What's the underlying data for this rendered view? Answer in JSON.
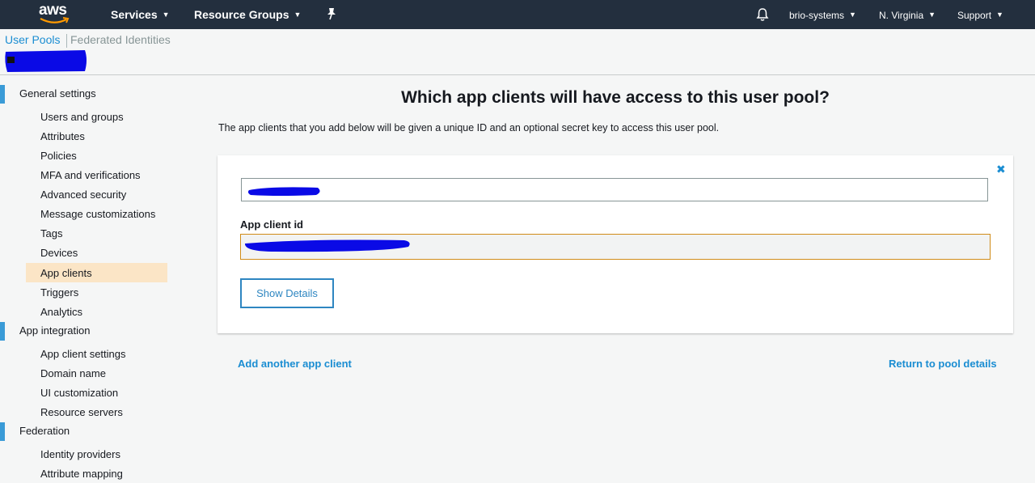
{
  "topbar": {
    "logo_text": "aws",
    "services_label": "Services",
    "resource_groups_label": "Resource Groups",
    "account_label": "brio-systems",
    "region_label": "N. Virginia",
    "support_label": "Support",
    "icons": [
      "pin-icon",
      "bell-icon",
      "caret-down-icon"
    ]
  },
  "subheader": {
    "tabs": [
      {
        "label": "User Pools"
      },
      {
        "label": "Federated Identities"
      }
    ]
  },
  "sidebar": {
    "sections": [
      {
        "label": "General settings"
      },
      {
        "label": "App integration"
      },
      {
        "label": "Federation"
      }
    ],
    "general_items": [
      {
        "label": "Users and groups"
      },
      {
        "label": "Attributes"
      },
      {
        "label": "Policies"
      },
      {
        "label": "MFA and verifications"
      },
      {
        "label": "Advanced security"
      },
      {
        "label": "Message customizations"
      },
      {
        "label": "Tags"
      },
      {
        "label": "Devices"
      },
      {
        "label": "App clients"
      },
      {
        "label": "Triggers"
      },
      {
        "label": "Analytics"
      }
    ],
    "app_integration_items": [
      {
        "label": "App client settings"
      },
      {
        "label": "Domain name"
      },
      {
        "label": "UI customization"
      },
      {
        "label": "Resource servers"
      }
    ],
    "federation_items": [
      {
        "label": "Identity providers"
      },
      {
        "label": "Attribute mapping"
      }
    ],
    "active_item": "App clients"
  },
  "main": {
    "title": "Which app clients will have access to this user pool?",
    "description": "The app clients that you add below will be given a unique ID and an optional secret key to access this user pool.",
    "card": {
      "close_symbol": "✖",
      "app_client_id_label": "App client id",
      "show_details_label": "Show Details"
    },
    "add_another_label": "Add another app client",
    "return_label": "Return to pool details"
  },
  "colors": {
    "topbar_bg": "#232f3e",
    "link_blue": "#1a8dd2",
    "active_item_bg": "#fbe5c6",
    "section_bar": "#3a9bd7",
    "redaction": "#0a0ae6"
  }
}
